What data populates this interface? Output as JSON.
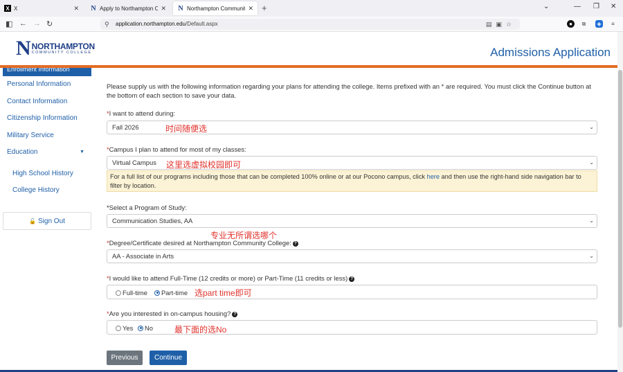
{
  "browser": {
    "tabs": [
      {
        "favicon": "X",
        "title": "X"
      },
      {
        "favicon": "N",
        "title": "Apply to Northampton Comm"
      },
      {
        "favicon": "N",
        "title": "Northampton Community Colle"
      }
    ],
    "new_tab": "+",
    "url_host": "application.northampton.edu",
    "url_path": "/Default.aspx"
  },
  "header": {
    "logo_letter": "N",
    "logo_name": "NORTHAMPTON",
    "logo_sub": "COMMUNITY COLLEGE",
    "title": "Admissions Application"
  },
  "sidebar": {
    "active": "Enrollment Information",
    "items": [
      {
        "label": "Personal Information"
      },
      {
        "label": "Contact Information"
      },
      {
        "label": "Citizenship Information"
      },
      {
        "label": "Military Service"
      },
      {
        "label": "Education"
      },
      {
        "label": "High School History"
      },
      {
        "label": "College History"
      }
    ],
    "sign_out": "Sign Out"
  },
  "form": {
    "intro": "Please supply us with the following information regarding your plans for attending the college. Items prefixed with an * are required. You must click the Continue button at the bottom of each section to save your data.",
    "attend_label": "I want to attend during:",
    "attend_value": "Fall 2026",
    "attend_note": "时间随便选",
    "campus_label": "Campus I plan to attend for most of my classes:",
    "campus_value": "Virtual Campus",
    "campus_note": "这里选虚拟校园即可",
    "info_before": "For a full list of our programs including those that can be completed 100% online or at our Pocono campus, click ",
    "info_link": "here",
    "info_after": " and then use the right-hand side navigation bar to filter by location.",
    "program_label": "Select a Program of Study:",
    "program_value": "Communication Studies, AA",
    "program_note": "专业无所谓选哪个",
    "degree_label": "Degree/Certificate desired at Northampton Community College:",
    "degree_value": "AA - Associate in Arts",
    "time_label": "I would like to attend Full-Time (12 credits or more) or Part-Time (11 credits or less)",
    "fulltime": "Full-time",
    "parttime": "Part-time",
    "time_note": "选part time即可",
    "housing_label": "Are you interested in on-campus housing?",
    "yes": "Yes",
    "no": "No",
    "housing_note": "最下面的选No",
    "prev_btn": "Previous",
    "continue_btn": "Continue"
  }
}
